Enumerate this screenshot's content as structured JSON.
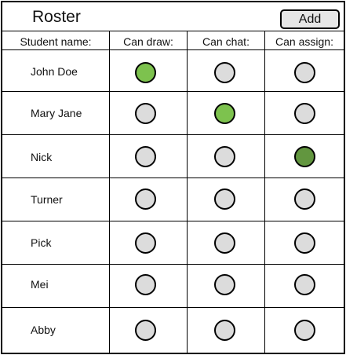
{
  "header": {
    "title": "Roster",
    "add_label": "Add"
  },
  "columns": [
    "Student name:",
    "Can draw:",
    "Can chat:",
    "Can assign:"
  ],
  "colors": {
    "off": "#dcdcdc",
    "on_light": "#7dc24e",
    "on_dark": "#62963f"
  },
  "rows": [
    {
      "name": "John Doe",
      "draw": true,
      "chat": false,
      "assign": false
    },
    {
      "name": "Mary Jane",
      "draw": false,
      "chat": true,
      "assign": false
    },
    {
      "name": "Nick",
      "draw": false,
      "chat": false,
      "assign": true
    },
    {
      "name": "Turner",
      "draw": false,
      "chat": false,
      "assign": false
    },
    {
      "name": "Pick",
      "draw": false,
      "chat": false,
      "assign": false
    },
    {
      "name": "Mei",
      "draw": false,
      "chat": false,
      "assign": false
    },
    {
      "name": "Abby",
      "draw": false,
      "chat": false,
      "assign": false
    }
  ]
}
